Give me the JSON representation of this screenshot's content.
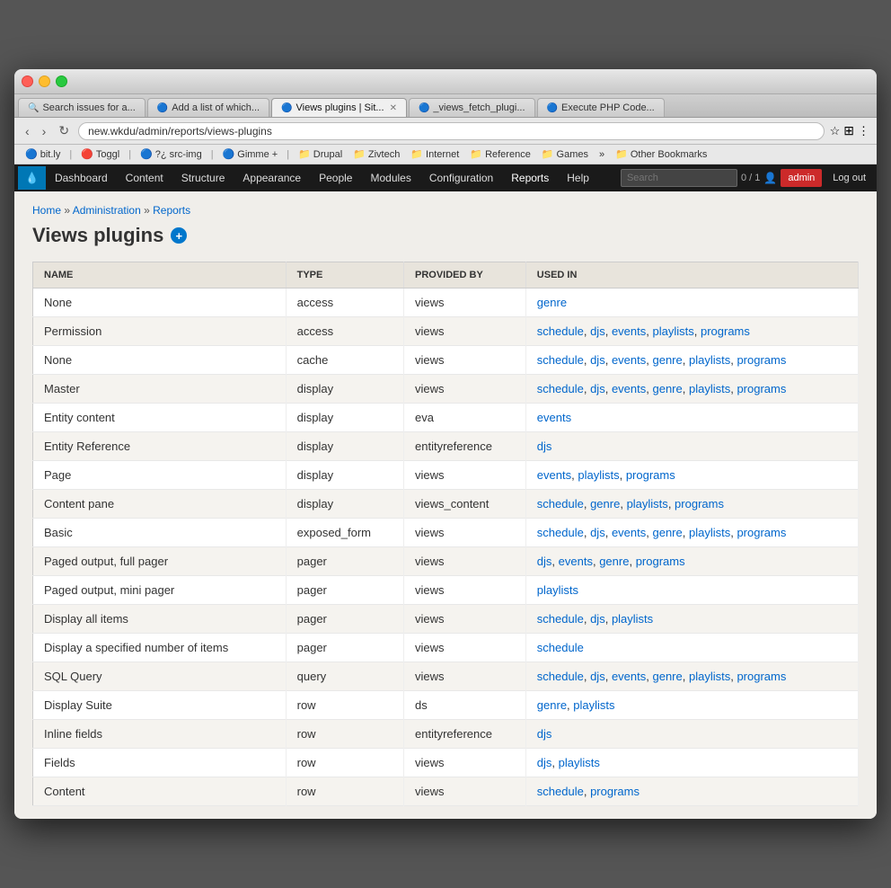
{
  "browser": {
    "tabs": [
      {
        "label": "Search issues for a...",
        "icon": "🔍",
        "active": false,
        "closable": false
      },
      {
        "label": "Add a list of which...",
        "icon": "🔵",
        "active": false,
        "closable": false
      },
      {
        "label": "Views plugins | Sit...",
        "icon": "🔵",
        "active": true,
        "closable": true
      },
      {
        "label": "_views_fetch_plugi...",
        "icon": "🔵",
        "active": false,
        "closable": false
      },
      {
        "label": "Execute PHP Code...",
        "icon": "🔵",
        "active": false,
        "closable": false
      }
    ],
    "url": "new.wkdu/admin/reports/views-plugins",
    "bookmarks": [
      {
        "label": "bit.ly",
        "icon": "🔵"
      },
      {
        "label": "Toggl",
        "icon": "🔴"
      },
      {
        "label": "?¿ src-img",
        "icon": "🔵"
      },
      {
        "label": "Gimme",
        "icon": "🔵",
        "extra": "+"
      },
      {
        "label": "Drupal",
        "icon": "📁"
      },
      {
        "label": "Zivtech",
        "icon": "📁"
      },
      {
        "label": "Internet",
        "icon": "📁"
      },
      {
        "label": "Reference",
        "icon": "📁"
      },
      {
        "label": "Games",
        "icon": "📁"
      },
      {
        "label": "»",
        "icon": ""
      },
      {
        "label": "Other Bookmarks",
        "icon": "📁"
      }
    ]
  },
  "drupal_nav": {
    "items": [
      "Dashboard",
      "Content",
      "Structure",
      "Appearance",
      "People",
      "Modules",
      "Configuration",
      "Reports",
      "Help"
    ],
    "search_placeholder": "Search",
    "count": "0 / 1",
    "user": "admin",
    "logout": "Log out"
  },
  "breadcrumb": {
    "items": [
      "Home",
      "Administration",
      "Reports"
    ],
    "separator": "»"
  },
  "page": {
    "title": "Views plugins",
    "add_icon": "+"
  },
  "table": {
    "headers": [
      "NAME",
      "TYPE",
      "PROVIDED BY",
      "USED IN"
    ],
    "rows": [
      {
        "name": "None",
        "type": "access",
        "provided_by": "views",
        "used_in": [
          {
            "text": "genre",
            "link": true
          }
        ]
      },
      {
        "name": "Permission",
        "type": "access",
        "provided_by": "views",
        "used_in": [
          {
            "text": "schedule",
            "link": true
          },
          {
            "text": ", ",
            "link": false
          },
          {
            "text": "djs",
            "link": true
          },
          {
            "text": ", ",
            "link": false
          },
          {
            "text": "events",
            "link": true
          },
          {
            "text": ", ",
            "link": false
          },
          {
            "text": "playlists",
            "link": true
          },
          {
            "text": ", ",
            "link": false
          },
          {
            "text": "programs",
            "link": true
          }
        ]
      },
      {
        "name": "None",
        "type": "cache",
        "provided_by": "views",
        "used_in": [
          {
            "text": "schedule",
            "link": true
          },
          {
            "text": ", ",
            "link": false
          },
          {
            "text": "djs",
            "link": true
          },
          {
            "text": ", ",
            "link": false
          },
          {
            "text": "events",
            "link": true
          },
          {
            "text": ", ",
            "link": false
          },
          {
            "text": "genre",
            "link": true
          },
          {
            "text": ", ",
            "link": false
          },
          {
            "text": "playlists",
            "link": true
          },
          {
            "text": ", ",
            "link": false
          },
          {
            "text": "programs",
            "link": true
          }
        ]
      },
      {
        "name": "Master",
        "type": "display",
        "provided_by": "views",
        "used_in": [
          {
            "text": "schedule",
            "link": true
          },
          {
            "text": ", ",
            "link": false
          },
          {
            "text": "djs",
            "link": true
          },
          {
            "text": ", ",
            "link": false
          },
          {
            "text": "events",
            "link": true
          },
          {
            "text": ", ",
            "link": false
          },
          {
            "text": "genre",
            "link": true
          },
          {
            "text": ", ",
            "link": false
          },
          {
            "text": "playlists",
            "link": true
          },
          {
            "text": ", ",
            "link": false
          },
          {
            "text": "programs",
            "link": true
          }
        ]
      },
      {
        "name": "Entity content",
        "type": "display",
        "provided_by": "eva",
        "used_in": [
          {
            "text": "events",
            "link": true
          }
        ]
      },
      {
        "name": "Entity Reference",
        "type": "display",
        "provided_by": "entityreference",
        "used_in": [
          {
            "text": "djs",
            "link": true
          }
        ]
      },
      {
        "name": "Page",
        "type": "display",
        "provided_by": "views",
        "used_in": [
          {
            "text": "events",
            "link": true
          },
          {
            "text": ", ",
            "link": false
          },
          {
            "text": "playlists",
            "link": true
          },
          {
            "text": ", ",
            "link": false
          },
          {
            "text": "programs",
            "link": true
          }
        ]
      },
      {
        "name": "Content pane",
        "type": "display",
        "provided_by": "views_content",
        "used_in": [
          {
            "text": "schedule",
            "link": true
          },
          {
            "text": ", ",
            "link": false
          },
          {
            "text": "genre",
            "link": true
          },
          {
            "text": ", ",
            "link": false
          },
          {
            "text": "playlists",
            "link": true
          },
          {
            "text": ", ",
            "link": false
          },
          {
            "text": "programs",
            "link": true
          }
        ]
      },
      {
        "name": "Basic",
        "type": "exposed_form",
        "provided_by": "views",
        "used_in": [
          {
            "text": "schedule",
            "link": true
          },
          {
            "text": ", ",
            "link": false
          },
          {
            "text": "djs",
            "link": true
          },
          {
            "text": ", ",
            "link": false
          },
          {
            "text": "events",
            "link": true
          },
          {
            "text": ", ",
            "link": false
          },
          {
            "text": "genre",
            "link": true
          },
          {
            "text": ", ",
            "link": false
          },
          {
            "text": "playlists",
            "link": true
          },
          {
            "text": ", ",
            "link": false
          },
          {
            "text": "programs",
            "link": true
          }
        ]
      },
      {
        "name": "Paged output, full pager",
        "type": "pager",
        "provided_by": "views",
        "used_in": [
          {
            "text": "djs",
            "link": true
          },
          {
            "text": ", ",
            "link": false
          },
          {
            "text": "events",
            "link": true
          },
          {
            "text": ", ",
            "link": false
          },
          {
            "text": "genre",
            "link": true
          },
          {
            "text": ", ",
            "link": false
          },
          {
            "text": "programs",
            "link": true
          }
        ]
      },
      {
        "name": "Paged output, mini pager",
        "type": "pager",
        "provided_by": "views",
        "used_in": [
          {
            "text": "playlists",
            "link": true
          }
        ]
      },
      {
        "name": "Display all items",
        "type": "pager",
        "provided_by": "views",
        "used_in": [
          {
            "text": "schedule",
            "link": true
          },
          {
            "text": ", ",
            "link": false
          },
          {
            "text": "djs",
            "link": true
          },
          {
            "text": ", ",
            "link": false
          },
          {
            "text": "playlists",
            "link": true
          }
        ]
      },
      {
        "name": "Display a specified number of items",
        "type": "pager",
        "provided_by": "views",
        "used_in": [
          {
            "text": "schedule",
            "link": true
          }
        ]
      },
      {
        "name": "SQL Query",
        "type": "query",
        "provided_by": "views",
        "used_in": [
          {
            "text": "schedule",
            "link": true
          },
          {
            "text": ", ",
            "link": false
          },
          {
            "text": "djs",
            "link": true
          },
          {
            "text": ", ",
            "link": false
          },
          {
            "text": "events",
            "link": true
          },
          {
            "text": ", ",
            "link": false
          },
          {
            "text": "genre",
            "link": true
          },
          {
            "text": ", ",
            "link": false
          },
          {
            "text": "playlists",
            "link": true
          },
          {
            "text": ", ",
            "link": false
          },
          {
            "text": "programs",
            "link": true
          }
        ]
      },
      {
        "name": "Display Suite",
        "type": "row",
        "provided_by": "ds",
        "used_in": [
          {
            "text": "genre",
            "link": true
          },
          {
            "text": ", ",
            "link": false
          },
          {
            "text": "playlists",
            "link": true
          }
        ]
      },
      {
        "name": "Inline fields",
        "type": "row",
        "provided_by": "entityreference",
        "used_in": [
          {
            "text": "djs",
            "link": true
          }
        ]
      },
      {
        "name": "Fields",
        "type": "row",
        "provided_by": "views",
        "used_in": [
          {
            "text": "djs",
            "link": true
          },
          {
            "text": ", ",
            "link": false
          },
          {
            "text": "playlists",
            "link": true
          }
        ]
      },
      {
        "name": "Content",
        "type": "row",
        "provided_by": "views",
        "used_in": [
          {
            "text": "schedule",
            "link": true
          },
          {
            "text": ", ",
            "link": false
          },
          {
            "text": "programs",
            "link": true
          }
        ]
      }
    ]
  }
}
